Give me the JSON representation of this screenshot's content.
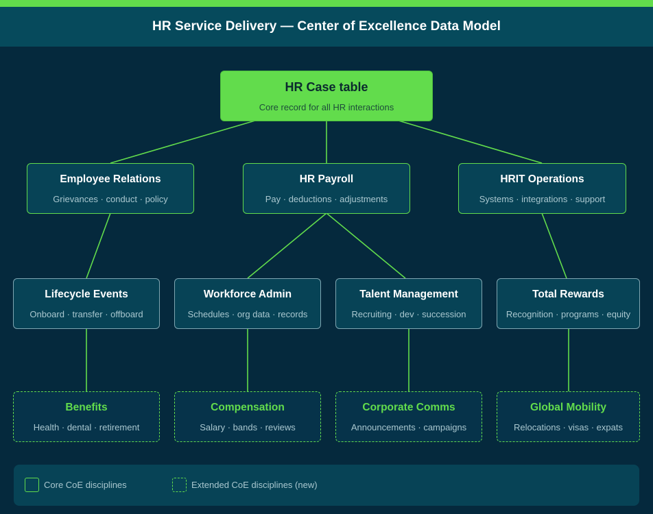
{
  "header": {
    "title": "HR Service Delivery — Center of Excellence Data Model"
  },
  "root": {
    "title": "HR Case table",
    "subtitle": "Core record for all HR interactions"
  },
  "level1": [
    {
      "title": "Employee Relations",
      "subtitle": "Grievances · conduct · policy"
    },
    {
      "title": "HR Payroll",
      "subtitle": "Pay · deductions · adjustments"
    },
    {
      "title": "HRIT Operations",
      "subtitle": "Systems · integrations · support"
    }
  ],
  "level2": [
    {
      "title": "Lifecycle Events",
      "subtitle": "Onboard · transfer · offboard"
    },
    {
      "title": "Workforce Admin",
      "subtitle": "Schedules · org data · records"
    },
    {
      "title": "Talent Management",
      "subtitle": "Recruiting · dev · succession"
    },
    {
      "title": "Total Rewards",
      "subtitle": "Recognition · programs · equity"
    }
  ],
  "level3": [
    {
      "title": "Benefits",
      "subtitle": "Health · dental · retirement"
    },
    {
      "title": "Compensation",
      "subtitle": "Salary · bands · reviews"
    },
    {
      "title": "Corporate Comms",
      "subtitle": "Announcements · campaigns"
    },
    {
      "title": "Global Mobility",
      "subtitle": "Relocations · visas · expats"
    }
  ],
  "legend": {
    "core_label": "Core CoE disciplines",
    "extended_label": "Extended CoE disciplines (new)"
  },
  "colors": {
    "background": "#05293d",
    "accent": "#62dc4c",
    "node_fill": "#074356",
    "header_fill": "#064a5c"
  }
}
